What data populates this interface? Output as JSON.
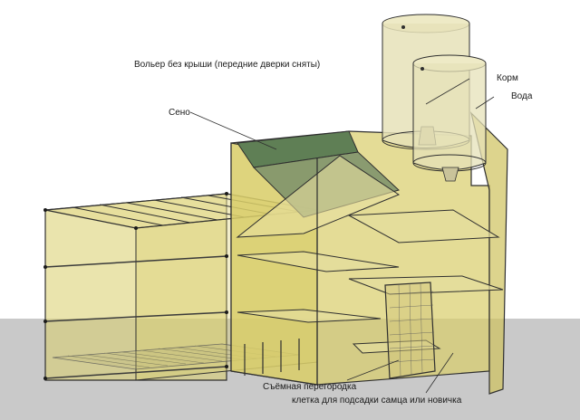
{
  "title": "Вольер без крыши  (передние дверки сняты)",
  "labels": {
    "hay": "Сено",
    "feed": "Корм",
    "water": "Вода",
    "partition": "Съёмная перегородка",
    "cage": "клетка для подсадки самца или новичка"
  },
  "colors": {
    "sky": "#ffffff",
    "ground": "#c9c9c9",
    "panel": "#d9cd6a",
    "frame": "#2f2f2f",
    "hay": "#5f7f55",
    "tank": "#e6e2b8"
  }
}
